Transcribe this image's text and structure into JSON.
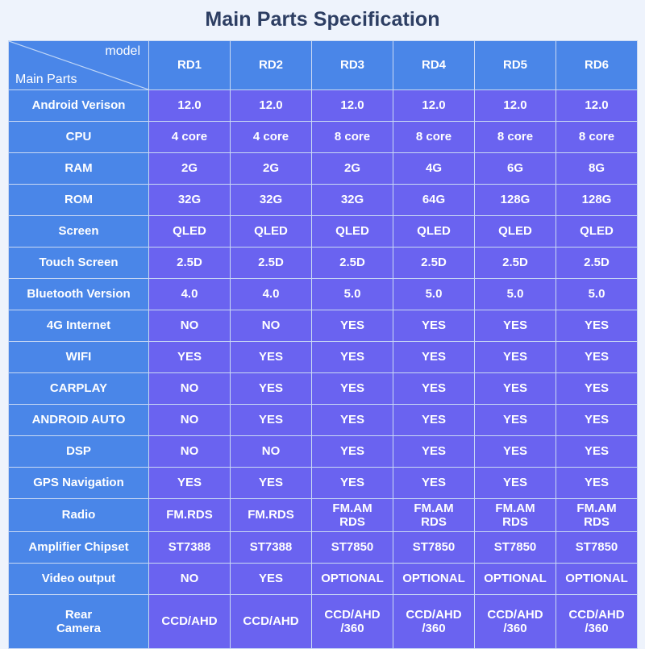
{
  "page": {
    "title": "Main Parts Specification",
    "background_color": "#eef3fc",
    "title_color": "#2d3e63",
    "header_color": "#4a86e8",
    "data_cell_color": "#6a63f0",
    "border_color": "#c9d9f4"
  },
  "table": {
    "corner": {
      "top_right_label": "model",
      "bottom_left_label": "Main Parts"
    },
    "models": [
      "RD1",
      "RD2",
      "RD3",
      "RD4",
      "RD5",
      "RD6"
    ],
    "rows": [
      {
        "label": "Android Verison",
        "label_weight": "normal",
        "value_weight": "bold",
        "values": [
          "12.0",
          "12.0",
          "12.0",
          "12.0",
          "12.0",
          "12.0"
        ]
      },
      {
        "label": "CPU",
        "label_weight": "normal",
        "value_weight": "bold",
        "values": [
          "4 core",
          "4 core",
          "8 core",
          "8 core",
          "8 core",
          "8 core"
        ]
      },
      {
        "label": "RAM",
        "label_weight": "normal",
        "value_weight": "bold",
        "values": [
          "2G",
          "2G",
          "2G",
          "4G",
          "6G",
          "8G"
        ]
      },
      {
        "label": "ROM",
        "label_weight": "normal",
        "value_weight": "bold",
        "values": [
          "32G",
          "32G",
          "32G",
          "64G",
          "128G",
          "128G"
        ]
      },
      {
        "label": "Screen",
        "label_weight": "bold",
        "value_weight": "normal",
        "values": [
          "QLED",
          "QLED",
          "QLED",
          "QLED",
          "QLED",
          "QLED"
        ]
      },
      {
        "label": "Touch Screen",
        "label_weight": "normal",
        "value_weight": "thin",
        "values": [
          "2.5D",
          "2.5D",
          "2.5D",
          "2.5D",
          "2.5D",
          "2.5D"
        ]
      },
      {
        "label": "Bluetooth Version",
        "label_weight": "bold",
        "value_weight": "bold",
        "values": [
          "4.0",
          "4.0",
          "5.0",
          "5.0",
          "5.0",
          "5.0"
        ]
      },
      {
        "label": "4G Internet",
        "label_weight": "normal",
        "value_weight": "bold",
        "values": [
          "NO",
          "NO",
          "YES",
          "YES",
          "YES",
          "YES"
        ]
      },
      {
        "label": "WIFI",
        "label_weight": "normal",
        "value_weight": "bold",
        "values": [
          "YES",
          "YES",
          "YES",
          "YES",
          "YES",
          "YES"
        ]
      },
      {
        "label": "CARPLAY",
        "label_weight": "normal",
        "value_weight": "bold",
        "values": [
          "NO",
          "YES",
          "YES",
          "YES",
          "YES",
          "YES"
        ]
      },
      {
        "label": "ANDROID AUTO",
        "label_weight": "normal",
        "value_weight": "bold",
        "values": [
          "NO",
          "YES",
          "YES",
          "YES",
          "YES",
          "YES"
        ]
      },
      {
        "label": "DSP",
        "label_weight": "normal",
        "value_weight": "bold",
        "values": [
          "NO",
          "NO",
          "YES",
          "YES",
          "YES",
          "YES"
        ]
      },
      {
        "label": "GPS Navigation",
        "label_weight": "normal",
        "value_weight": "bold",
        "values": [
          "YES",
          "YES",
          "YES",
          "YES",
          "YES",
          "YES"
        ]
      },
      {
        "label": "Radio",
        "label_weight": "normal",
        "value_weight": "bold",
        "values": [
          "FM.RDS",
          "FM.RDS",
          "FM.AM\nRDS",
          "FM.AM\nRDS",
          "FM.AM\nRDS",
          "FM.AM\nRDS"
        ]
      },
      {
        "label": "Amplifier Chipset",
        "label_weight": "normal",
        "value_weight": "bold",
        "values": [
          "ST7388",
          "ST7388",
          "ST7850",
          "ST7850",
          "ST7850",
          "ST7850"
        ]
      },
      {
        "label": "Video output",
        "label_weight": "normal",
        "value_weight": "thin",
        "values": [
          "NO",
          "YES",
          "OPTIONAL",
          "OPTIONAL",
          "OPTIONAL",
          "OPTIONAL"
        ]
      },
      {
        "label": "Rear\nCamera",
        "label_weight": "bold",
        "value_weight": "bold",
        "values": [
          "CCD/AHD",
          "CCD/AHD",
          "CCD/AHD\n/360",
          "CCD/AHD\n/360",
          "CCD/AHD\n/360",
          "CCD/AHD\n/360"
        ]
      }
    ]
  }
}
